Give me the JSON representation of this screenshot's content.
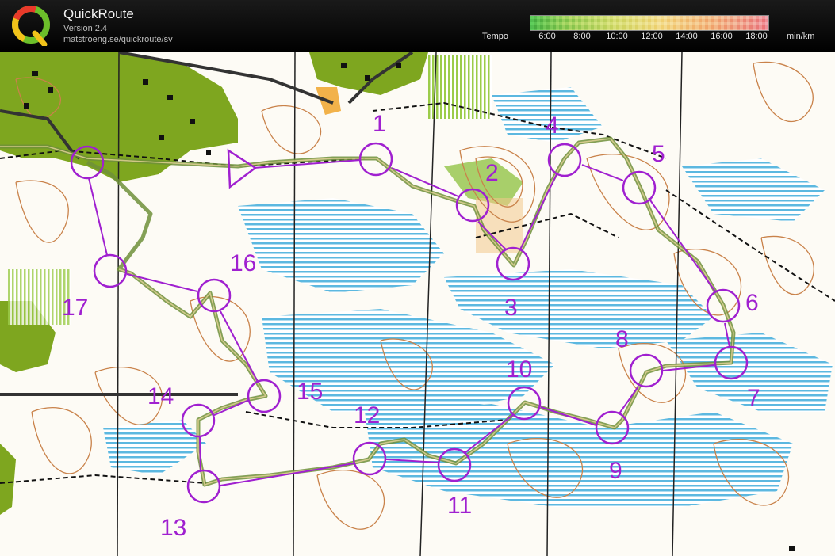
{
  "app": {
    "title": "QuickRoute",
    "version": "Version 2.4",
    "url": "matstroeng.se/quickroute/sv",
    "logo_letter": "Q"
  },
  "legend": {
    "label": "Tempo",
    "unit": "min/km",
    "ticks": [
      "6:00",
      "8:00",
      "10:00",
      "12:00",
      "14:00",
      "16:00",
      "18:00"
    ]
  },
  "map": {
    "controls": [
      "1",
      "2",
      "3",
      "4",
      "5",
      "6",
      "7",
      "8",
      "9",
      "10",
      "11",
      "12",
      "13",
      "14",
      "15",
      "16",
      "17"
    ],
    "colors": {
      "course": "#a020d0",
      "route": "#6f8f3a",
      "forest": "#7ea61f",
      "marsh": "#3aa7d8",
      "contour": "#c9824a",
      "paths": "#000000"
    }
  }
}
